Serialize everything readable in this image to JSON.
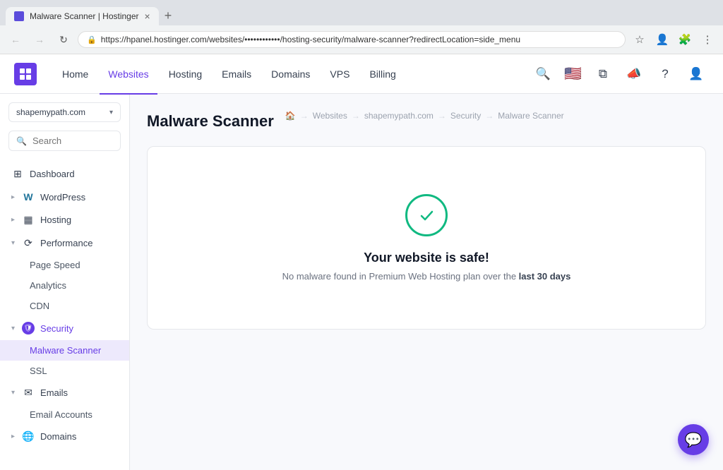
{
  "browser": {
    "tab_title": "Malware Scanner | Hostinger",
    "url": "https://hpanel.hostinger.com/websites/••••••••••••/hosting-security/malware-scanner?redirectLocation=side_menu",
    "new_tab_label": "+"
  },
  "topnav": {
    "logo_letter": "H",
    "links": [
      {
        "label": "Home",
        "active": false
      },
      {
        "label": "Websites",
        "active": true
      },
      {
        "label": "Hosting",
        "active": false
      },
      {
        "label": "Emails",
        "active": false
      },
      {
        "label": "Domains",
        "active": false
      },
      {
        "label": "VPS",
        "active": false
      },
      {
        "label": "Billing",
        "active": false
      }
    ]
  },
  "sidebar": {
    "domain": "shapemypath.com",
    "search_placeholder": "Search",
    "items": [
      {
        "id": "dashboard",
        "label": "Dashboard",
        "icon": "⊞",
        "type": "item"
      },
      {
        "id": "wordpress",
        "label": "WordPress",
        "icon": "W",
        "type": "expandable"
      },
      {
        "id": "hosting",
        "label": "Hosting",
        "icon": "▦",
        "type": "expandable"
      },
      {
        "id": "performance",
        "label": "Performance",
        "icon": "⟳",
        "type": "expandable-open",
        "children": [
          {
            "id": "page-speed",
            "label": "Page Speed"
          },
          {
            "id": "analytics",
            "label": "Analytics"
          },
          {
            "id": "cdn",
            "label": "CDN"
          }
        ]
      },
      {
        "id": "security",
        "label": "Security",
        "icon": "🛡",
        "type": "expandable-open",
        "children": [
          {
            "id": "malware-scanner",
            "label": "Malware Scanner",
            "active": true
          },
          {
            "id": "ssl",
            "label": "SSL"
          }
        ]
      },
      {
        "id": "emails",
        "label": "Emails",
        "icon": "✉",
        "type": "expandable-open",
        "children": [
          {
            "id": "email-accounts",
            "label": "Email Accounts"
          }
        ]
      },
      {
        "id": "domains",
        "label": "Domains",
        "icon": "🌐",
        "type": "expandable"
      }
    ]
  },
  "breadcrumb": {
    "items": [
      "🏠",
      "Websites",
      "shapemypath.com",
      "Security",
      "Malware Scanner"
    ],
    "separators": [
      "→",
      "→",
      "→",
      "→"
    ]
  },
  "page": {
    "title": "Malware Scanner",
    "card": {
      "headline": "Your website is safe!",
      "description_prefix": "No malware found in Premium Web Hosting plan over the ",
      "description_bold": "last 30 days"
    }
  }
}
